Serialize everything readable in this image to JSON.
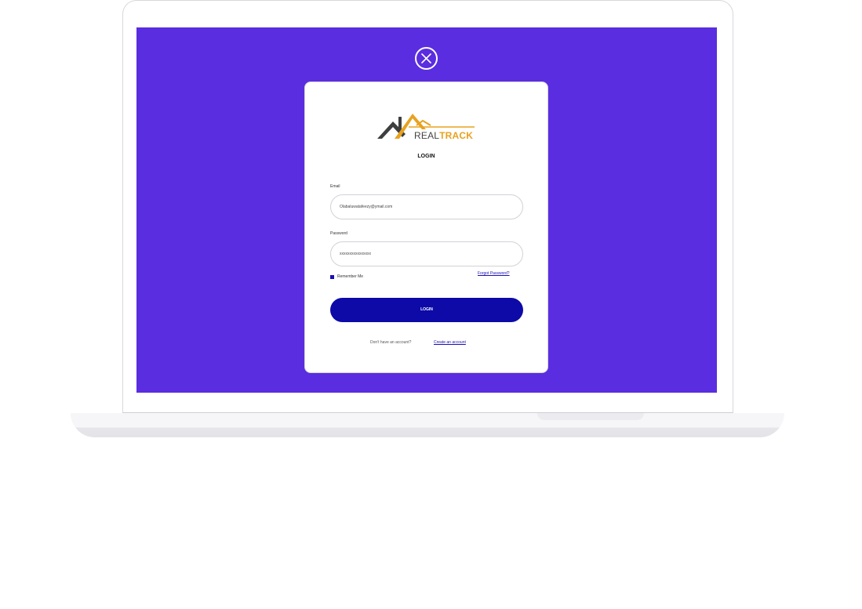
{
  "modal": {
    "close_icon": "close-circle-icon",
    "logo": {
      "word1": "REAL",
      "word2": "TRACK",
      "icon": "house-roofs-logo",
      "colors": {
        "dark": "#3e3e3e",
        "accent": "#e8a21e"
      }
    },
    "title": "LOGIN",
    "email": {
      "label": "Email",
      "value": "Olabaluwatafeezy@ymail.com"
    },
    "password": {
      "label": "Password",
      "value": "xxxxxxxxxxxxxxxx"
    },
    "remember_label": "Remember Me",
    "forgot_link": "Forgot Password?",
    "login_button": "LOGIN",
    "signup_prompt": "Don't have an account?",
    "signup_link": "Create an account"
  },
  "colors": {
    "screen_background": "#5a2de0",
    "primary_button": "#0d0aa8",
    "link": "#1a0fb6",
    "card": "#ffffff"
  }
}
